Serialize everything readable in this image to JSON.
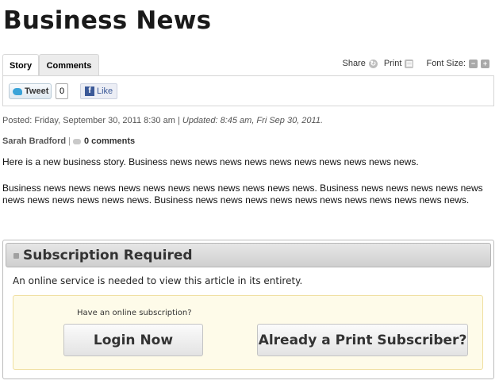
{
  "page": {
    "title": "Business News"
  },
  "tabs": [
    {
      "label": "Story",
      "active": true
    },
    {
      "label": "Comments",
      "active": false
    }
  ],
  "tools": {
    "share_label": "Share",
    "print_label": "Print",
    "font_size_label": "Font Size:",
    "icons": [
      "share-icon",
      "print-icon",
      "font-decrease-icon",
      "font-increase-icon"
    ]
  },
  "social": {
    "tweet_label": "Tweet",
    "tweet_count": "0",
    "like_label": "Like"
  },
  "article": {
    "posted": "Posted: Friday, September 30, 2011 8:30 am |",
    "updated": "Updated: 8:45 am, Fri Sep 30, 2011.",
    "author": "Sarah Bradford",
    "separator": "|",
    "comments": "0 comments",
    "paragraph1": "Here is a new business story. Business news news news news news news news news news news.",
    "paragraph2": "Business news news news news news news news news news news news. Business news news news news news news news news news news news. Business news news news news news news news news news news news."
  },
  "subscription": {
    "heading": "Subscription Required",
    "note": "An online service is needed to view this article in its entirety.",
    "question": "Have an online subscription?",
    "login_label": "Login Now",
    "print_label": "Already a Print Subscriber?"
  },
  "colors": {
    "panel_bg": "#fefbe9",
    "panel_border": "#f0dfa0",
    "facebook": "#3b5998",
    "twitter": "#3aa3d8"
  }
}
